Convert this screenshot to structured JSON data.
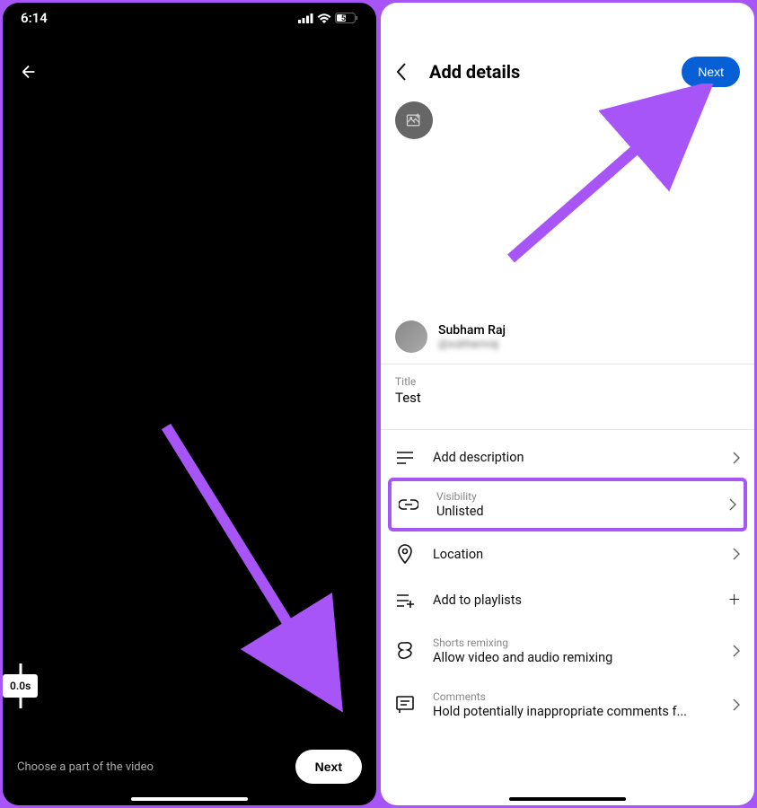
{
  "left": {
    "statusTime": "6:14",
    "battery": "51",
    "timelinePosition": "0.0s",
    "promptText": "Choose a part of the video",
    "nextLabel": "Next"
  },
  "right": {
    "headerTitle": "Add details",
    "nextLabel": "Next",
    "author": {
      "name": "Subham Raj",
      "handle": "@subhamraj"
    },
    "title": {
      "label": "Title",
      "value": "Test"
    },
    "options": {
      "description": {
        "label": "Add description"
      },
      "visibility": {
        "subtitle": "Visibility",
        "value": "Unlisted"
      },
      "location": {
        "label": "Location"
      },
      "playlists": {
        "label": "Add to playlists"
      },
      "remixing": {
        "subtitle": "Shorts remixing",
        "value": "Allow video and audio remixing"
      },
      "comments": {
        "subtitle": "Comments",
        "value": "Hold potentially inappropriate comments f..."
      }
    }
  }
}
